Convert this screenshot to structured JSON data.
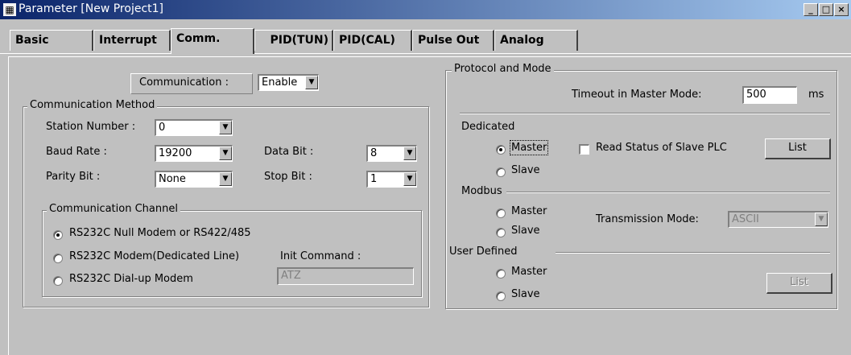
{
  "window": {
    "title": "Parameter [New Project1]",
    "icon": "grid-icon",
    "controls": [
      "_",
      "□",
      "×"
    ]
  },
  "tabs": [
    {
      "label": "Basic"
    },
    {
      "label": "Interrupt"
    },
    {
      "label": "Comm."
    },
    {
      "label": "PID(TUN)"
    },
    {
      "label": "PID(CAL)"
    },
    {
      "label": "Pulse Out"
    },
    {
      "label": "Analog"
    }
  ],
  "communication": {
    "label": "Communication :",
    "value": "Enable"
  },
  "method": {
    "title": "Communication Method",
    "station_label": "Station Number :",
    "station_value": "0",
    "baud_label": "Baud Rate :",
    "baud_value": "19200",
    "databit_label": "Data Bit :",
    "databit_value": "8",
    "parity_label": "Parity Bit :",
    "parity_value": "None",
    "stopbit_label": "Stop Bit :",
    "stopbit_value": "1"
  },
  "channel": {
    "title": "Communication Channel",
    "opt1": "RS232C Null Modem or RS422/485",
    "opt2": "RS232C Modem(Dedicated Line)",
    "opt3": "RS232C Dial-up Modem",
    "init_label": "Init Command :",
    "init_value": "ATZ"
  },
  "protocol": {
    "title": "Protocol and Mode",
    "timeout_label": "Timeout in Master Mode:",
    "timeout_value": "500",
    "timeout_unit": "ms",
    "dedicated": "Dedicated",
    "master": "Master",
    "slave": "Slave",
    "read_status": "Read Status of Slave PLC",
    "list": "List",
    "modbus": "Modbus",
    "transmission_label": "Transmission Mode:",
    "transmission_value": "ASCII",
    "user_defined": "User Defined"
  }
}
